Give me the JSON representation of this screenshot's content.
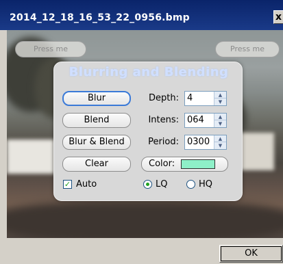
{
  "window": {
    "title": "2014_12_18_16_53_22_0956.bmp",
    "close_label": "x"
  },
  "background_buttons": {
    "left_label": "Press me",
    "right_label": "Press me"
  },
  "panel": {
    "title": "Blurring and Blending",
    "buttons": {
      "blur": "Blur",
      "blend": "Blend",
      "blur_blend": "Blur & Blend",
      "clear": "Clear"
    },
    "depth": {
      "label": "Depth:",
      "value": "4"
    },
    "intens": {
      "label": "Intens:",
      "value": "064"
    },
    "period": {
      "label": "Period:",
      "value": "0300"
    },
    "color": {
      "label": "Color:",
      "swatch": "#8ef0c8"
    },
    "auto": {
      "label": "Auto",
      "checked": true
    },
    "quality": {
      "options": [
        "LQ",
        "HQ"
      ],
      "selected": "LQ"
    }
  },
  "dialog": {
    "ok_label": "OK"
  }
}
